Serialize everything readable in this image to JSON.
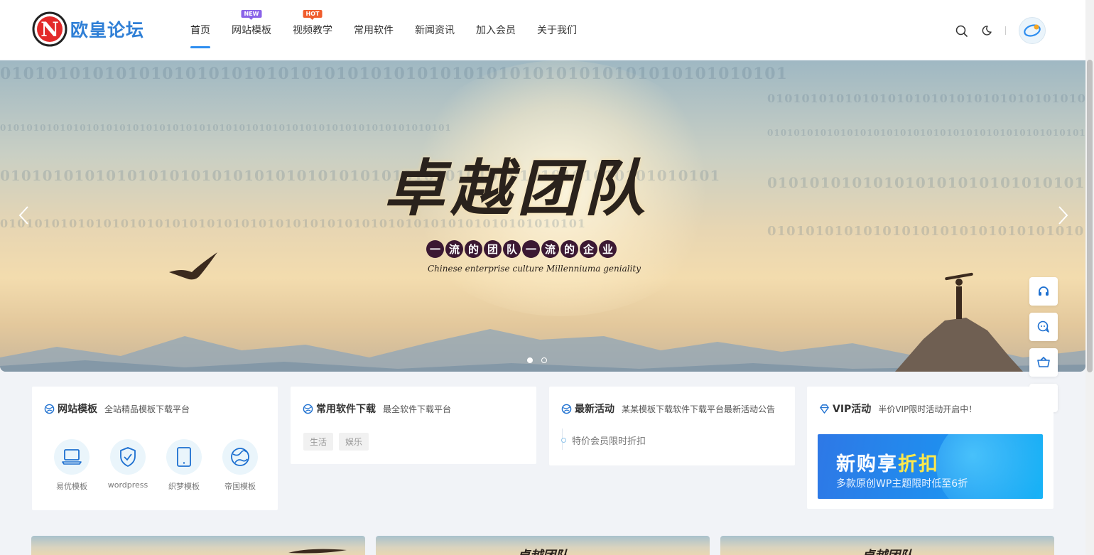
{
  "site": {
    "logo_text": "欧皇论坛",
    "logo_icon": "N-logo-icon"
  },
  "nav": {
    "items": [
      {
        "label": "首页",
        "active": true,
        "badge": ""
      },
      {
        "label": "网站模板",
        "active": false,
        "badge": "NEW"
      },
      {
        "label": "视频教学",
        "active": false,
        "badge": "HOT"
      },
      {
        "label": "常用软件",
        "active": false,
        "badge": ""
      },
      {
        "label": "新闻资讯",
        "active": false,
        "badge": ""
      },
      {
        "label": "加入会员",
        "active": false,
        "badge": ""
      },
      {
        "label": "关于我们",
        "active": false,
        "badge": ""
      }
    ]
  },
  "header_tools": {
    "icons": [
      "search-icon",
      "moon-icon",
      "user-avatar"
    ]
  },
  "banner": {
    "title": "卓越团队",
    "subtitle_chars": [
      "一",
      "流",
      "的",
      "团",
      "队",
      "一",
      "流",
      "的",
      "企",
      "业"
    ],
    "english": "Chinese enterprise culture   Millenniuma geniality",
    "binary_text": "01010101010101010101010101010101010101010101010101010101010101010101",
    "slide_count": 2,
    "active_slide": 1
  },
  "float_tools": {
    "icons": [
      "headset-icon",
      "chat-icon",
      "basket-icon",
      "back-to-top-icon"
    ]
  },
  "cards": {
    "templates": {
      "title": "网站模板",
      "desc": "全站精品模板下载平台",
      "categories": [
        {
          "label": "易优模板",
          "icon": "laptop-icon"
        },
        {
          "label": "wordpress",
          "icon": "shield-check-icon"
        },
        {
          "label": "织梦模板",
          "icon": "tablet-icon"
        },
        {
          "label": "帝国模板",
          "icon": "globe-icon"
        }
      ]
    },
    "software": {
      "title": "常用软件下载",
      "desc": "最全软件下载平台",
      "tags": [
        "生活",
        "娱乐"
      ]
    },
    "activity": {
      "title": "最新活动",
      "desc": "某某模板下载软件下载平台最新活动公告",
      "items": [
        "特价会员限时折扣"
      ]
    },
    "vip": {
      "title": "VIP活动",
      "desc": "半价VIP限时活动开启中！",
      "banner_line1_prefix": "新购享",
      "banner_line1_highlight": "折扣",
      "banner_line2": "多款原创WP主题限时低至6折"
    }
  },
  "colors": {
    "accent": "#2e8ef0",
    "badge_new": "#8a63e8",
    "badge_hot": "#f05d2d",
    "vip_highlight": "#ffe94a"
  }
}
